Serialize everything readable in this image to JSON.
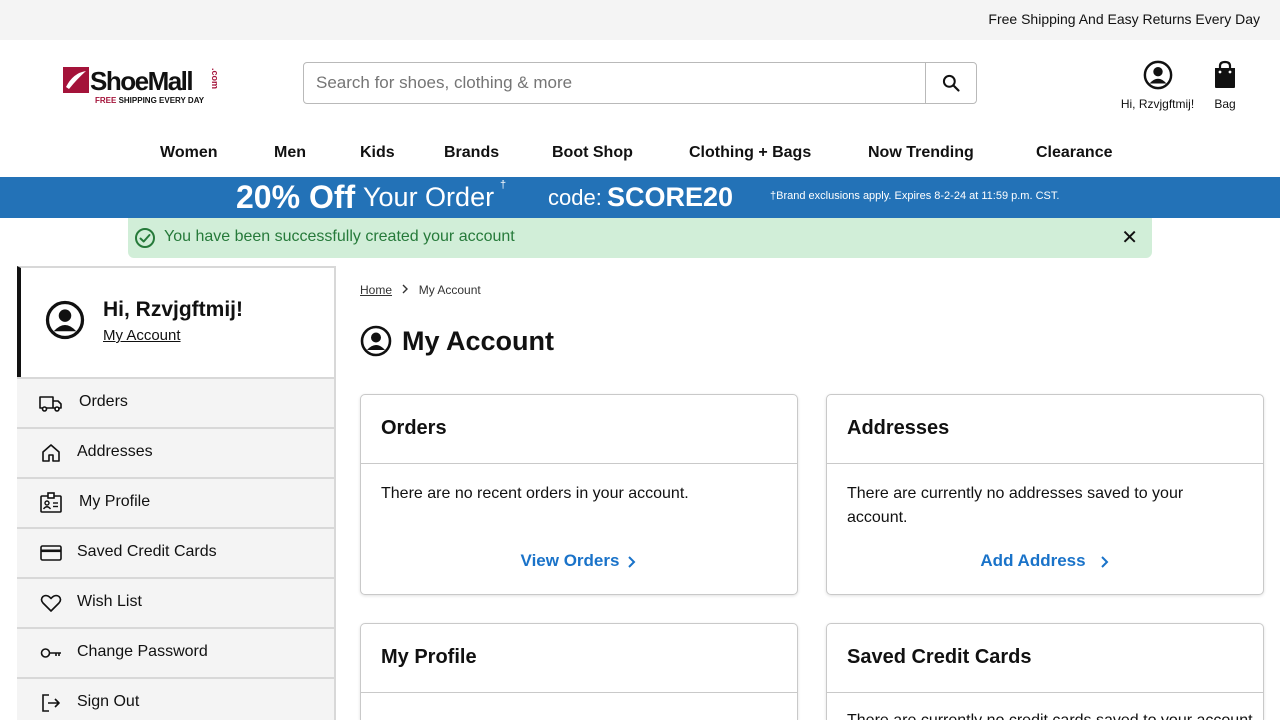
{
  "topbar": {
    "message": "Free Shipping And Easy Returns Every Day"
  },
  "logo": {
    "brand": "ShoeMall",
    "domain": ".com",
    "tag_free": "FREE",
    "tag_rest": " SHIPPING EVERY DAY"
  },
  "search": {
    "placeholder": "Search for shoes, clothing & more",
    "value": ""
  },
  "header": {
    "account_label": "Hi, Rzvjgftmij!",
    "bag_label": "Bag"
  },
  "nav": [
    {
      "label": "Women"
    },
    {
      "label": "Men"
    },
    {
      "label": "Kids"
    },
    {
      "label": "Brands"
    },
    {
      "label": "Boot Shop"
    },
    {
      "label": "Clothing + Bags"
    },
    {
      "label": "Now Trending"
    },
    {
      "label": "Clearance"
    }
  ],
  "promo": {
    "percent": "20% Off",
    "rest": "Your Order",
    "dagger": "†",
    "code_label": "code:",
    "code": "SCORE20",
    "fine_print": "†Brand exclusions apply. Expires 8-2-24 at 11:59 p.m. CST.",
    "color": "#2372b7"
  },
  "alert": {
    "message": "You have been successfully created your account",
    "close": "✕",
    "color": "#267a3a"
  },
  "sidebar": {
    "greeting": "Hi, Rzvjgftmij!",
    "account_link": "My Account",
    "items": [
      {
        "label": "Orders",
        "icon": "truck-icon"
      },
      {
        "label": "Addresses",
        "icon": "home-icon"
      },
      {
        "label": "My Profile",
        "icon": "id-card-icon"
      },
      {
        "label": "Saved Credit Cards",
        "icon": "credit-card-icon"
      },
      {
        "label": "Wish List",
        "icon": "heart-icon"
      },
      {
        "label": "Change Password",
        "icon": "key-icon"
      },
      {
        "label": "Sign Out",
        "icon": "sign-out-icon"
      }
    ]
  },
  "breadcrumb": {
    "home": "Home",
    "current": "My Account"
  },
  "main": {
    "title": "My Account",
    "cards": [
      {
        "title": "Orders",
        "body": "There are no recent orders in your account.",
        "link": "View Orders"
      },
      {
        "title": "Addresses",
        "body": "There are currently no addresses saved to your account.",
        "link": "Add Address"
      },
      {
        "title": "My Profile",
        "body": "",
        "link": ""
      },
      {
        "title": "Saved Credit Cards",
        "body": "There are currently no credit cards saved to your account.",
        "link": ""
      }
    ]
  }
}
